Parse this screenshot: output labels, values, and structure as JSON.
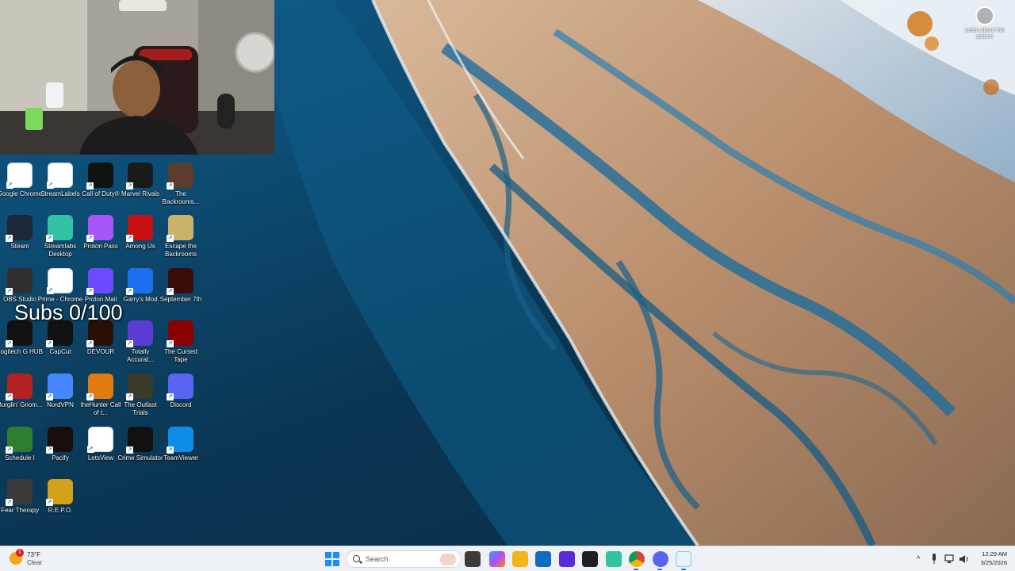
{
  "desktop": {
    "overlay_text": "Subs 0/100",
    "learn_about_label": "Learn about this picture",
    "icons": [
      {
        "label": "Google Chrome",
        "icon": "chrome-icon",
        "color": "#ffffff"
      },
      {
        "label": "StreamLabels",
        "icon": "streamlabels-icon",
        "color": "#ffffff"
      },
      {
        "label": "Call of Duty®",
        "icon": "call-of-duty-icon",
        "color": "#111111"
      },
      {
        "label": "Marvel Rivals",
        "icon": "marvel-rivals-icon",
        "color": "#1b1b1b"
      },
      {
        "label": "The Backrooms...",
        "icon": "backrooms-icon",
        "color": "#5a3d2e"
      },
      {
        "label": "Steam",
        "icon": "steam-icon",
        "color": "#1b2838"
      },
      {
        "label": "Streamlabs Desktop",
        "icon": "streamlabs-desktop-icon",
        "color": "#31c3a2"
      },
      {
        "label": "Proton Pass",
        "icon": "proton-pass-icon",
        "color": "#a855f7"
      },
      {
        "label": "Among Us",
        "icon": "among-us-icon",
        "color": "#c51111"
      },
      {
        "label": "Escape the Backrooms",
        "icon": "escape-backrooms-icon",
        "color": "#c9b36a"
      },
      {
        "label": "OBS Studio",
        "icon": "obs-icon",
        "color": "#302e31"
      },
      {
        "label": "Prime - Chrome",
        "icon": "chrome-icon",
        "color": "#ffffff"
      },
      {
        "label": "Proton Mail",
        "icon": "proton-mail-icon",
        "color": "#6d4aff"
      },
      {
        "label": "Garry's Mod",
        "icon": "garrys-mod-icon",
        "color": "#1e6ff0"
      },
      {
        "label": "September 7th",
        "icon": "september-7th-icon",
        "color": "#3a0d0d"
      },
      {
        "label": "Logitech G HUB",
        "icon": "logitech-icon",
        "color": "#111111"
      },
      {
        "label": "CapCut",
        "icon": "capcut-icon",
        "color": "#111111"
      },
      {
        "label": "DEVOUR",
        "icon": "devour-icon",
        "color": "#2a0f05"
      },
      {
        "label": "Totally Accurat...",
        "icon": "totally-accurate-icon",
        "color": "#5b3bd1"
      },
      {
        "label": "The Cursed Tape",
        "icon": "cursed-tape-icon",
        "color": "#8b0000"
      },
      {
        "label": "Burglin' Gnom...",
        "icon": "burglin-gnomes-icon",
        "color": "#b22222"
      },
      {
        "label": "NordVPN",
        "icon": "nordvpn-icon",
        "color": "#4687ff"
      },
      {
        "label": "theHunter Call of t...",
        "icon": "thehunter-icon",
        "color": "#e07b10"
      },
      {
        "label": "The Outlast Trials",
        "icon": "outlast-trials-icon",
        "color": "#3a3a2a"
      },
      {
        "label": "Discord",
        "icon": "discord-icon",
        "color": "#5865f2"
      },
      {
        "label": "Schedule I",
        "icon": "schedule-i-icon",
        "color": "#2e7d32"
      },
      {
        "label": "Pacify",
        "icon": "pacify-icon",
        "color": "#1a0d0d"
      },
      {
        "label": "LetsView",
        "icon": "letsview-icon",
        "color": "#ffffff"
      },
      {
        "label": "Crime Simulator",
        "icon": "crime-simulator-icon",
        "color": "#111111"
      },
      {
        "label": "TeamViewer",
        "icon": "teamviewer-icon",
        "color": "#0e8ee9"
      },
      {
        "label": "Fear Therapy",
        "icon": "fear-therapy-icon",
        "color": "#3a3a3a"
      },
      {
        "label": "R.E.P.O.",
        "icon": "repo-icon",
        "color": "#d4a017"
      }
    ]
  },
  "taskbar": {
    "weather": {
      "temp": "73°F",
      "condition": "Clear",
      "badge": "1"
    },
    "search_placeholder": "Search",
    "clock": {
      "time": "12:29 AM",
      "date": "3/25/2026"
    },
    "tray_chevron": "^"
  }
}
